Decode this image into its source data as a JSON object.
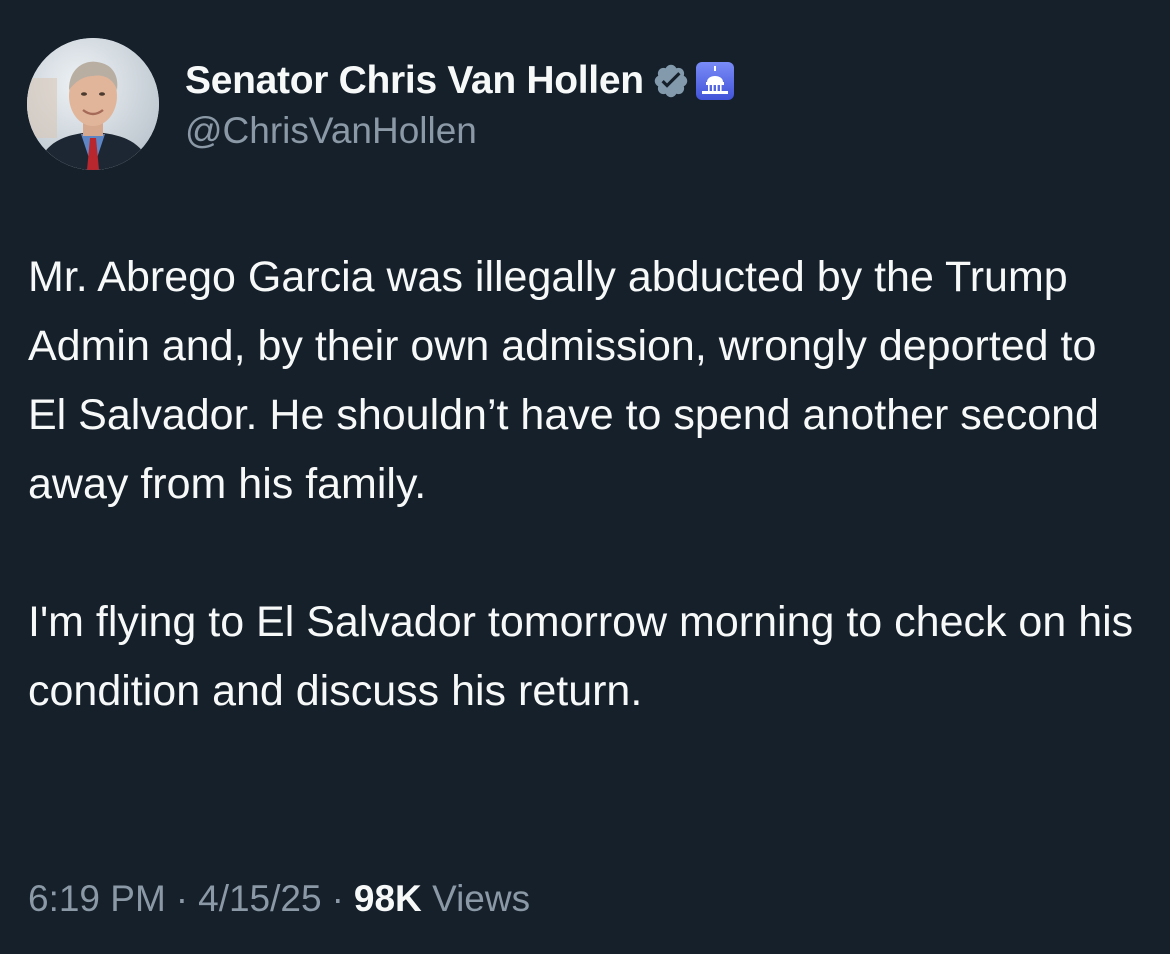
{
  "tweet": {
    "author": {
      "display_name": "Senator Chris Van Hollen",
      "handle": "@ChrisVanHollen",
      "verified_badge_icon": "verified-badge-icon",
      "affiliation_icon": "us-capitol-icon",
      "colors": {
        "verified_badge": "#829aab",
        "affiliation_badge": "#5b6cf0"
      }
    },
    "text": {
      "paragraph_1": "Mr. Abrego Garcia was illegally abducted by the Trump Admin and, by their own admission, wrongly deported to El Salvador. He shouldn’t have to spend another second away from his family.",
      "paragraph_2": "I'm flying to El Salvador tomorrow morning to check on his condition and discuss his return."
    },
    "meta": {
      "time": "6:19 PM",
      "separator": "·",
      "date": "4/15/25",
      "views_count": "98K",
      "views_label": "Views"
    }
  },
  "colors": {
    "background": "#15202b",
    "primary_text": "#f7f9f9",
    "secondary_text": "#8b98a5"
  }
}
